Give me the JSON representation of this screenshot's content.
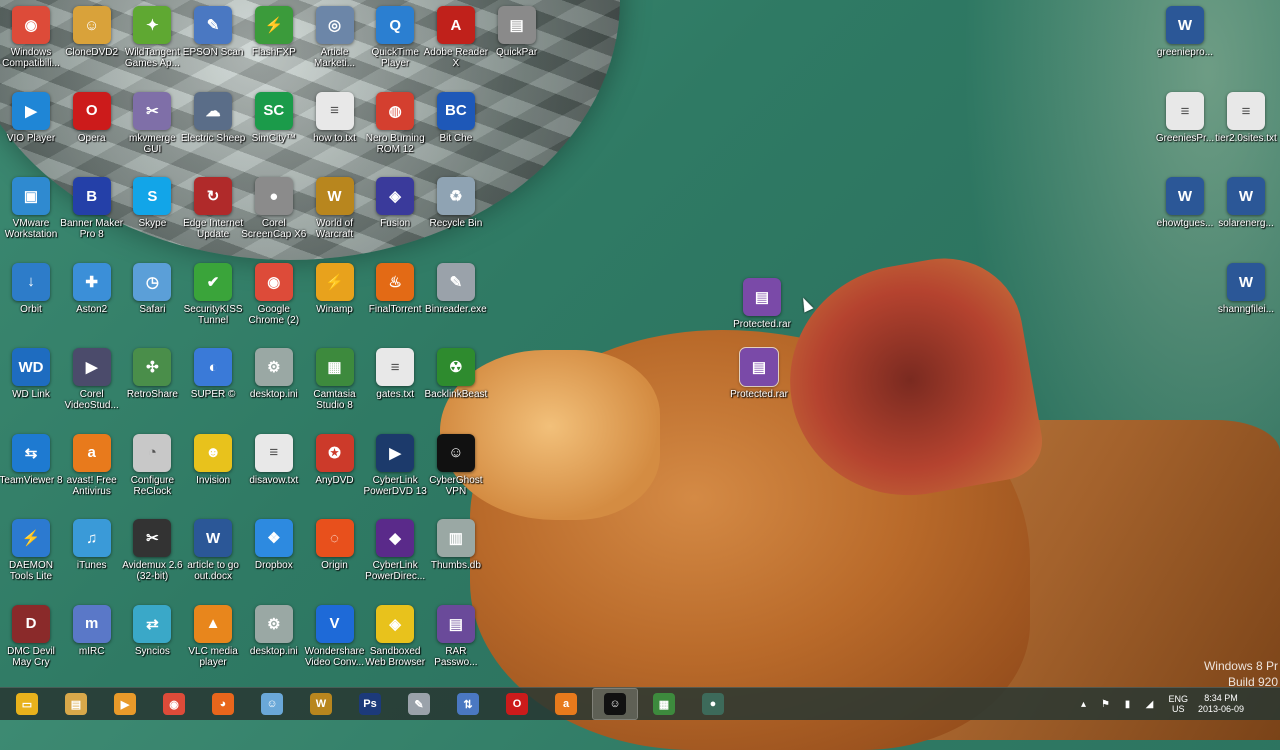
{
  "desktop": {
    "icons": [
      {
        "label": "Windows Compatibili...",
        "icon": "chrome-icon",
        "color": "#dd4b39",
        "glyph": "◉"
      },
      {
        "label": "CloneDVD2",
        "icon": "clonedvd-icon",
        "color": "#d9a23a",
        "glyph": "☺"
      },
      {
        "label": "WildTangent Games Ap...",
        "icon": "wildtangent-icon",
        "color": "#5fa832",
        "glyph": "✦"
      },
      {
        "label": "EPSON Scan",
        "icon": "epson-scan-icon",
        "color": "#4a78c2",
        "glyph": "✎"
      },
      {
        "label": "FlashFXP",
        "icon": "flashfxp-icon",
        "color": "#3b9b3b",
        "glyph": "⚡"
      },
      {
        "label": "Article Marketi...",
        "icon": "article-marketing-icon",
        "color": "#6c86a8",
        "glyph": "◎"
      },
      {
        "label": "QuickTime Player",
        "icon": "quicktime-icon",
        "color": "#2b7fd1",
        "glyph": "Q"
      },
      {
        "label": "Adobe Reader X",
        "icon": "adobe-reader-icon",
        "color": "#c0211b",
        "glyph": "A"
      },
      {
        "label": "QuickPar",
        "icon": "quickpar-icon",
        "color": "#8a8a8a",
        "glyph": "▤"
      },
      {
        "label": "VIO Player",
        "icon": "vio-player-icon",
        "color": "#1f86d6",
        "glyph": "▶"
      },
      {
        "label": "Opera",
        "icon": "opera-icon",
        "color": "#cc1b1b",
        "glyph": "O"
      },
      {
        "label": "mkvmerge GUI",
        "icon": "mkvmerge-icon",
        "color": "#7f6fa8",
        "glyph": "✂"
      },
      {
        "label": "Electric Sheep",
        "icon": "electric-sheep-icon",
        "color": "#5a6d88",
        "glyph": "☁"
      },
      {
        "label": "SimCity™",
        "icon": "simcity-icon",
        "color": "#1b9b4a",
        "glyph": "SC"
      },
      {
        "label": "how to.txt",
        "icon": "text-file-icon",
        "color": "#e8e8e8",
        "glyph": "≡"
      },
      {
        "label": "Nero Burning ROM 12",
        "icon": "nero-icon",
        "color": "#d43f2f",
        "glyph": "◍"
      },
      {
        "label": "Bit Che",
        "icon": "bitche-icon",
        "color": "#1e58b8",
        "glyph": "BC"
      },
      {
        "label": "VMware Workstation",
        "icon": "vmware-icon",
        "color": "#2f8ad0",
        "glyph": "▣"
      },
      {
        "label": "Banner Maker Pro 8",
        "icon": "banner-maker-icon",
        "color": "#2440a8",
        "glyph": "B"
      },
      {
        "label": "Skype",
        "icon": "skype-icon",
        "color": "#12a5e8",
        "glyph": "S"
      },
      {
        "label": "Edge Internet Update",
        "icon": "edge-update-icon",
        "color": "#b02a2a",
        "glyph": "↻"
      },
      {
        "label": "Corel ScreenCap X6",
        "icon": "screencap-icon",
        "color": "#8b8b8b",
        "glyph": "●"
      },
      {
        "label": "World of Warcraft",
        "icon": "wow-icon",
        "color": "#b8861e",
        "glyph": "W"
      },
      {
        "label": "Fusion",
        "icon": "fusion-icon",
        "color": "#3a3a9b",
        "glyph": "◈"
      },
      {
        "label": "Recycle Bin",
        "icon": "recycle-bin-icon",
        "color": "#8fa3b3",
        "glyph": "♻"
      },
      {
        "label": "Orbit",
        "icon": "orbit-icon",
        "color": "#2d7cc9",
        "glyph": "↓"
      },
      {
        "label": "Aston2",
        "icon": "aston-icon",
        "color": "#3b8fd8",
        "glyph": "✚"
      },
      {
        "label": "Safari",
        "icon": "safari-icon",
        "color": "#5b9fd8",
        "glyph": "◷"
      },
      {
        "label": "SecurityKISS Tunnel",
        "icon": "securitykiss-icon",
        "color": "#3aa43a",
        "glyph": "✔"
      },
      {
        "label": "Google Chrome (2)",
        "icon": "chrome-icon",
        "color": "#dd4b39",
        "glyph": "◉"
      },
      {
        "label": "Winamp",
        "icon": "winamp-icon",
        "color": "#e8a21c",
        "glyph": "⚡"
      },
      {
        "label": "FinalTorrent",
        "icon": "finaltorrent-icon",
        "color": "#e36a15",
        "glyph": "♨"
      },
      {
        "label": "Binreader.exe",
        "icon": "binreader-icon",
        "color": "#9aa2aa",
        "glyph": "✎"
      },
      {
        "label": "WD Link",
        "icon": "wd-link-icon",
        "color": "#1e6cc0",
        "glyph": "WD"
      },
      {
        "label": "Corel VideoStud...",
        "icon": "videostudio-icon",
        "color": "#4b4b6b",
        "glyph": "▶"
      },
      {
        "label": "RetroShare",
        "icon": "retroshare-icon",
        "color": "#4a8e4a",
        "glyph": "✣"
      },
      {
        "label": "SUPER ©",
        "icon": "super-icon",
        "color": "#3a7ad8",
        "glyph": "◐"
      },
      {
        "label": "desktop.ini",
        "icon": "settings-file-icon",
        "color": "#9aa8a4",
        "glyph": "⚙"
      },
      {
        "label": "Camtasia Studio 8",
        "icon": "camtasia-icon",
        "color": "#3d8a3d",
        "glyph": "▦"
      },
      {
        "label": "gates.txt",
        "icon": "text-file-icon",
        "color": "#e8e8e8",
        "glyph": "≡"
      },
      {
        "label": "BacklinkBeast",
        "icon": "backlinkbeast-icon",
        "color": "#2e8b2e",
        "glyph": "☢"
      },
      {
        "label": "TeamViewer 8",
        "icon": "teamviewer-icon",
        "color": "#1e7ad1",
        "glyph": "⇆"
      },
      {
        "label": "avast! Free Antivirus",
        "icon": "avast-icon",
        "color": "#e87a1c",
        "glyph": "a"
      },
      {
        "label": "Configure ReClock",
        "icon": "reclock-icon",
        "color": "#c8c8c8",
        "glyph": "◔"
      },
      {
        "label": "Invision",
        "icon": "invision-icon",
        "color": "#e8c21c",
        "glyph": "☻"
      },
      {
        "label": "disavow.txt",
        "icon": "text-file-icon",
        "color": "#e8e8e8",
        "glyph": "≡"
      },
      {
        "label": "AnyDVD",
        "icon": "anydvd-icon",
        "color": "#cc3a2a",
        "glyph": "✪"
      },
      {
        "label": "CyberLink PowerDVD 13",
        "icon": "powerdvd-icon",
        "color": "#1c3a6b",
        "glyph": "▶"
      },
      {
        "label": "CyberGhost VPN",
        "icon": "cyberghost-icon",
        "color": "#111111",
        "glyph": "☺"
      },
      {
        "label": "DAEMON Tools Lite",
        "icon": "daemon-tools-icon",
        "color": "#2c7ad0",
        "glyph": "⚡"
      },
      {
        "label": "iTunes",
        "icon": "itunes-icon",
        "color": "#3a9ad8",
        "glyph": "♫"
      },
      {
        "label": "Avidemux 2.6 (32-bit)",
        "icon": "avidemux-icon",
        "color": "#333333",
        "glyph": "✂"
      },
      {
        "label": "article to go out.docx",
        "icon": "word-doc-icon",
        "color": "#2b5797",
        "glyph": "W"
      },
      {
        "label": "Dropbox",
        "icon": "dropbox-icon",
        "color": "#2d8ae0",
        "glyph": "❖"
      },
      {
        "label": "Origin",
        "icon": "origin-icon",
        "color": "#e8501c",
        "glyph": "◌"
      },
      {
        "label": "CyberLink PowerDirec...",
        "icon": "powerdirector-icon",
        "color": "#5a2a8a",
        "glyph": "◆"
      },
      {
        "label": "Thumbs.db",
        "icon": "thumbs-db-icon",
        "color": "#9aa8a4",
        "glyph": "▥"
      },
      {
        "label": "DMC Devil May Cry",
        "icon": "dmc-icon",
        "color": "#8a2a2a",
        "glyph": "D"
      },
      {
        "label": "mIRC",
        "icon": "mirc-icon",
        "color": "#5a78c8",
        "glyph": "m"
      },
      {
        "label": "Syncios",
        "icon": "syncios-icon",
        "color": "#3aa8c8",
        "glyph": "⇄"
      },
      {
        "label": "VLC media player",
        "icon": "vlc-icon",
        "color": "#e8861c",
        "glyph": "▲"
      },
      {
        "label": "desktop.ini",
        "icon": "settings-file-icon",
        "color": "#9aa8a4",
        "glyph": "⚙"
      },
      {
        "label": "Wondershare Video Conv...",
        "icon": "wondershare-icon",
        "color": "#1e6ad8",
        "glyph": "V"
      },
      {
        "label": "Sandboxed Web Browser",
        "icon": "sandboxed-icon",
        "color": "#e8c21c",
        "glyph": "◈"
      },
      {
        "label": "RAR Passwo...",
        "icon": "rar-password-icon",
        "color": "#6a4a9a",
        "glyph": "▤"
      }
    ],
    "right_icons": [
      {
        "label": "greeniepro...",
        "icon": "word-doc-icon",
        "color": "#2b5797",
        "glyph": "W"
      },
      {
        "label": "GreeniesPr...",
        "icon": "text-file-icon",
        "color": "#e8e8e8",
        "glyph": "≡"
      },
      {
        "label": "tier2.0sites.txt",
        "icon": "text-file-icon",
        "color": "#e8e8e8",
        "glyph": "≡"
      },
      {
        "label": "ehowtgues...",
        "icon": "word-doc-icon",
        "color": "#2b5797",
        "glyph": "W"
      },
      {
        "label": "solarenerg...",
        "icon": "word-doc-icon",
        "color": "#2b5797",
        "glyph": "W"
      },
      {
        "label": "shanngfilei...",
        "icon": "word-doc-icon",
        "color": "#2b5797",
        "glyph": "W"
      }
    ],
    "floating_icons": [
      {
        "label": "Protected.rar",
        "icon": "winrar-archive-icon",
        "color": "#7a4aa8",
        "glyph": "▤"
      },
      {
        "label": "Protected.rar",
        "icon": "winrar-archive-icon",
        "color": "#7a4aa8",
        "glyph": "▤"
      }
    ],
    "watermark": {
      "line1": "Windows 8 Pr",
      "line2": "Build 920"
    }
  },
  "taskbar": {
    "apps": [
      {
        "icon": "file-explorer-icon",
        "color": "#e8b21c",
        "glyph": "▭"
      },
      {
        "icon": "libraries-icon",
        "color": "#d8a84a",
        "glyph": "▤"
      },
      {
        "icon": "media-player-icon",
        "color": "#e89a2a",
        "glyph": "▶"
      },
      {
        "icon": "chrome-icon",
        "color": "#dd4b39",
        "glyph": "◉"
      },
      {
        "icon": "firefox-icon",
        "color": "#e8661c",
        "glyph": "◕"
      },
      {
        "icon": "messenger-icon",
        "color": "#6aa8d8",
        "glyph": "☺"
      },
      {
        "icon": "wow-icon",
        "color": "#b8861e",
        "glyph": "W"
      },
      {
        "icon": "photoshop-icon",
        "color": "#1c3a7a",
        "glyph": "Ps"
      },
      {
        "icon": "binreader-icon",
        "color": "#9aa2aa",
        "glyph": "✎"
      },
      {
        "icon": "network-tool-icon",
        "color": "#4a78c2",
        "glyph": "⇅"
      },
      {
        "icon": "opera-icon",
        "color": "#cc1b1b",
        "glyph": "O"
      },
      {
        "icon": "avast-icon",
        "color": "#e87a1c",
        "glyph": "a"
      },
      {
        "icon": "cyberghost-icon",
        "color": "#111111",
        "glyph": "☺"
      },
      {
        "icon": "camtasia-icon",
        "color": "#3d8a3d",
        "glyph": "▦"
      },
      {
        "icon": "camtasia-recorder-icon",
        "color": "#3d6a5a",
        "glyph": "●"
      }
    ],
    "active_index": 12,
    "tray": {
      "lang_line1": "ENG",
      "lang_line2": "US",
      "time": "8:34 PM",
      "date": "2013-06-09"
    }
  }
}
